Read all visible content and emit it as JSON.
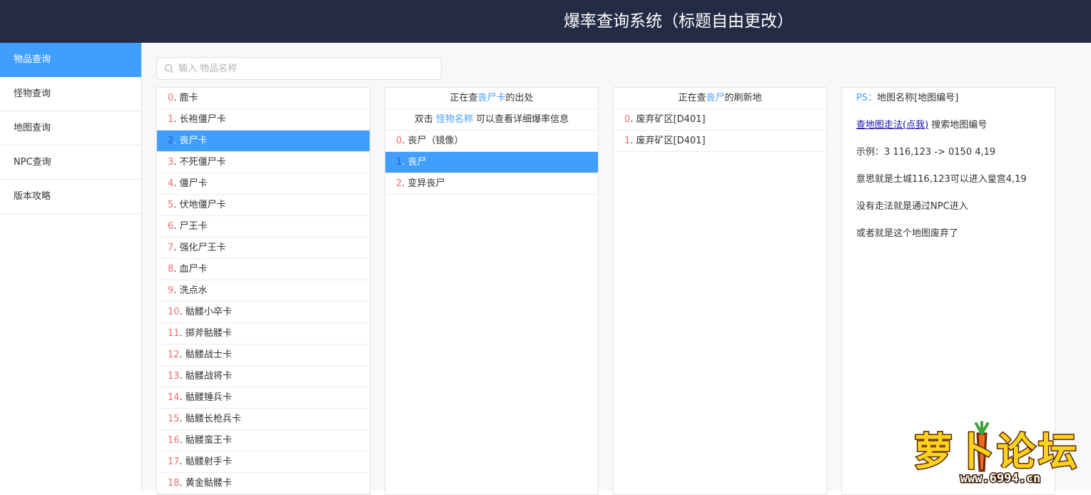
{
  "header": {
    "title": "爆率查询系统（标题自由更改）"
  },
  "sidebar": {
    "items": [
      {
        "label": "物品查询",
        "active": true
      },
      {
        "label": "怪物查询",
        "active": false
      },
      {
        "label": "地图查询",
        "active": false
      },
      {
        "label": "NPC查询",
        "active": false
      },
      {
        "label": "版本攻略",
        "active": false
      }
    ]
  },
  "search": {
    "placeholder": "输入 物品名称",
    "value": ""
  },
  "items_panel": {
    "selected_index": 2,
    "items": [
      {
        "index": "0",
        "name": "鹿卡"
      },
      {
        "index": "1",
        "name": "长袍僵尸卡"
      },
      {
        "index": "2",
        "name": "丧尸卡"
      },
      {
        "index": "3",
        "name": "不死僵尸卡"
      },
      {
        "index": "4",
        "name": "僵尸卡"
      },
      {
        "index": "5",
        "name": "伏地僵尸卡"
      },
      {
        "index": "6",
        "name": "尸王卡"
      },
      {
        "index": "7",
        "name": "强化尸王卡"
      },
      {
        "index": "8",
        "name": "血尸卡"
      },
      {
        "index": "9",
        "name": "洗点水"
      },
      {
        "index": "10",
        "name": "骷髅小卒卡"
      },
      {
        "index": "11",
        "name": "掷斧骷髅卡"
      },
      {
        "index": "12",
        "name": "骷髅战士卡"
      },
      {
        "index": "13",
        "name": "骷髅战将卡"
      },
      {
        "index": "14",
        "name": "骷髅锤兵卡"
      },
      {
        "index": "15",
        "name": "骷髅长枪兵卡"
      },
      {
        "index": "16",
        "name": "骷髅蛮王卡"
      },
      {
        "index": "17",
        "name": "骷髅射手卡"
      },
      {
        "index": "18",
        "name": "黄金骷髅卡"
      }
    ]
  },
  "monsters_panel": {
    "header_prefix": "正在查",
    "header_item": "丧尸卡",
    "header_suffix": "的出处",
    "hint_prefix": "双击",
    "hint_highlight": "怪物名称",
    "hint_suffix": "可以查看详细爆率信息",
    "selected_index": 1,
    "items": [
      {
        "index": "0",
        "name": "丧尸（镜像）"
      },
      {
        "index": "1",
        "name": "丧尸"
      },
      {
        "index": "2",
        "name": "变异丧尸"
      }
    ]
  },
  "maps_panel": {
    "header_prefix": "正在查",
    "header_monster": "丧尸",
    "header_suffix": "的刷新地",
    "items": [
      {
        "index": "0",
        "name": "废弃矿区[D401]"
      },
      {
        "index": "1",
        "name": "废弃矿区[D401]"
      }
    ]
  },
  "info_panel": {
    "ps_label": "PS：",
    "ps_text": "地图名称[地图编号]",
    "link_text": "查地图走法(点我)",
    "link_suffix": "搜索地图编号",
    "example": "示例：3 116,123 -> 0150 4,19",
    "meaning": "意思就是土城116,123可以进入皇宫4,19",
    "no_route": "没有走法就是通过NPC进入",
    "abandoned": "或者就是这个地图废弃了"
  },
  "watermark": {
    "text": "萝卜论坛",
    "domain": "www.6994.cn"
  },
  "colors": {
    "header_bg": "#242b45",
    "accent": "#409eff",
    "index_red": "#f56c6c",
    "link": "#1a0dab"
  }
}
